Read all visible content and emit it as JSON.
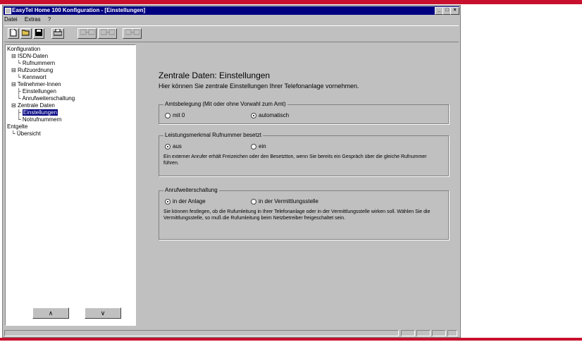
{
  "window": {
    "title": "EasyTel Home 100 Konfiguration - [Einstellungen]",
    "controls": [
      "_",
      "□",
      "×"
    ]
  },
  "menu": [
    "Datei",
    "Extras",
    "?"
  ],
  "toolbar": {
    "buttons": [
      "new-doc-icon",
      "open-icon",
      "save-icon",
      "print-icon"
    ],
    "disabled_buttons": [
      "transfer-icon",
      "transfer-icon",
      "transfer-icon"
    ]
  },
  "tree": [
    {
      "label": "Konfiguration",
      "level": 0
    },
    {
      "label": "ISDN-Daten",
      "level": 1
    },
    {
      "label": "Rufnummern",
      "level": 2
    },
    {
      "label": "Rufzuordnung",
      "level": 1
    },
    {
      "label": "Kennwort",
      "level": 2
    },
    {
      "label": "Teilnehmer-Innen",
      "level": 1
    },
    {
      "label": "Einstellungen",
      "level": 2
    },
    {
      "label": "Anrufweiterschaltung",
      "level": 2
    },
    {
      "label": "Zentrale Daten",
      "level": 1
    },
    {
      "label": "Einstellungen",
      "level": 2,
      "selected": true
    },
    {
      "label": "Notrufnummern",
      "level": 2
    },
    {
      "label": "Entgelte",
      "level": 0
    },
    {
      "label": "Übersicht",
      "level": 1
    }
  ],
  "pager": {
    "prev": "∧",
    "next": "∨"
  },
  "content": {
    "heading": "Zentrale Daten: Einstellungen",
    "subheading": "Hier können Sie zentrale Einstellungen Ihrer Telefonanlage vornehmen.",
    "group1": {
      "legend": "Amtsbelegung (Mit oder ohne Vorwahl zum Amt)",
      "opt1": "mit 0",
      "opt2": "automatisch"
    },
    "group2": {
      "legend": "Leistungsmerkmal Rufnummer besetzt",
      "opt1": "aus",
      "opt2": "ein",
      "desc": "Ein externer Anrufer erhält Freizeichen oder den Besetztton, wenn Sie bereits ein Gespräch über die gleiche Rufnummer führen."
    },
    "group3": {
      "legend": "Anrufweiterschaltung",
      "opt1": "in der Anlage",
      "opt2": "in der Vermittlungsstelle",
      "desc": "Sie können festlegen, ob die Rufumleitung in Ihrer Telefonanlage oder in der Vermittlungsstelle wirken soll. Wählen Sie die Vermittlungsstelle, so muß die Rufumleitung beim Netzbetreiber freigeschaltet sein."
    }
  },
  "colors": {
    "accent": "#c8102e",
    "titlebar": "#000080",
    "face": "#c0c0c0"
  }
}
